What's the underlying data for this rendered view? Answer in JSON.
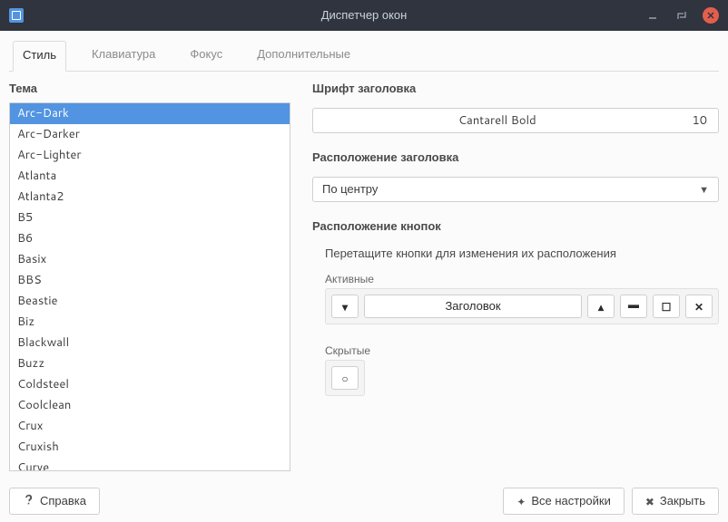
{
  "window": {
    "title": "Диспетчер окон"
  },
  "tabs": {
    "style": "Стиль",
    "keyboard": "Клавиатура",
    "focus": "Фокус",
    "advanced": "Дополнительные"
  },
  "theme": {
    "label": "Тема",
    "selected": "Arc-Dark",
    "items": [
      "Arc-Dark",
      "Arc-Darker",
      "Arc-Lighter",
      "Atlanta",
      "Atlanta2",
      "B5",
      "B6",
      "Basix",
      "BBS",
      "Beastie",
      "Biz",
      "Blackwall",
      "Buzz",
      "Coldsteel",
      "Coolclean",
      "Crux",
      "Cruxish",
      "Curve"
    ]
  },
  "title_font": {
    "label": "Шрифт заголовка",
    "name": "Cantarell Bold",
    "size": "10"
  },
  "title_align": {
    "label": "Расположение заголовка",
    "value": "По центру"
  },
  "button_layout": {
    "label": "Расположение кнопок",
    "hint": "Перетащите кнопки для изменения их расположения",
    "active_label": "Активные",
    "title_btn": "Заголовок",
    "hidden_label": "Скрытые"
  },
  "footer": {
    "help": "Справка",
    "all_settings": "Все настройки",
    "close": "Закрыть"
  }
}
